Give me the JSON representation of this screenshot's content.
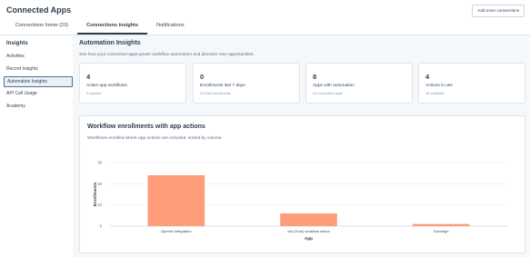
{
  "app": {
    "title": "Connected Apps",
    "add_button": "Add more connections"
  },
  "tabs": [
    {
      "label": "Connections home (23)"
    },
    {
      "label": "Connections insights"
    },
    {
      "label": "Notifications"
    }
  ],
  "sidebar": {
    "heading": "Insights",
    "items": [
      {
        "label": "Activities"
      },
      {
        "label": "Record Insights"
      },
      {
        "label": "Automation Insights"
      },
      {
        "label": "API Call Usage"
      },
      {
        "label": "Academy"
      }
    ]
  },
  "main": {
    "title": "Automation Insights",
    "description": "See how your connected apps power workflow automation and discover new opportunities."
  },
  "cards": [
    {
      "value": "4",
      "label": "Active app workflows",
      "sub": "4 inactive"
    },
    {
      "value": "0",
      "label": "Enrollments last 7 days",
      "sub": "31 total enrollments"
    },
    {
      "value": "8",
      "label": "Apps with automation",
      "sub": "23 connected apps"
    },
    {
      "value": "4",
      "label": "Actions in use",
      "sub": "16 available"
    }
  ],
  "chart_card": {
    "title": "Workflow enrollments with app actions",
    "subtitle": "Workflows enrolled where app actions are included, sorted by volume."
  },
  "chart_data": {
    "type": "bar",
    "categories": [
      "OpenAI Integration",
      "xAI (Grok) workflow action",
      "Docusign"
    ],
    "values": [
      24,
      6,
      1
    ],
    "xlabel": "App",
    "ylabel": "Enrollments",
    "yticks": [
      0,
      10,
      20,
      30
    ],
    "ylim": [
      0,
      30
    ],
    "grid": true,
    "color": "#ff9c7a"
  }
}
